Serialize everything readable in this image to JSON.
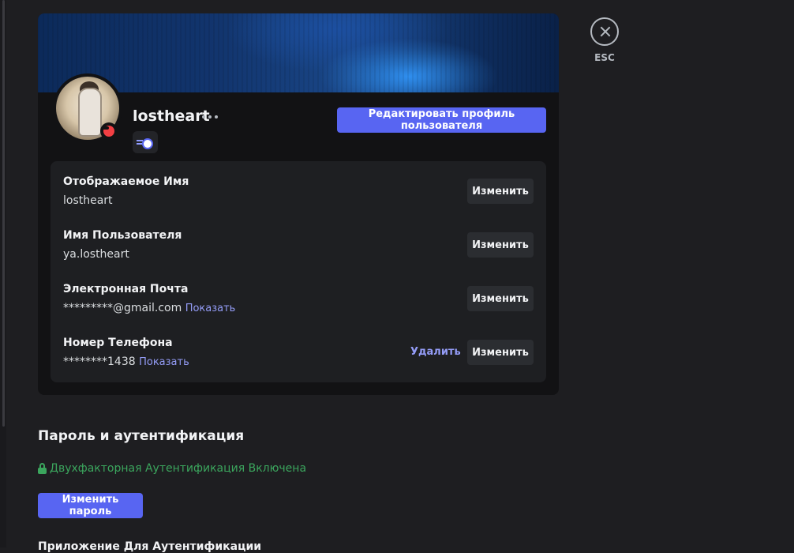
{
  "profile": {
    "username": "lostheart",
    "edit_button": "Редактировать профиль пользователя"
  },
  "fields": [
    {
      "label": "Отображаемое Имя",
      "value": "lostheart",
      "button": "Изменить"
    },
    {
      "label": "Имя Пользователя",
      "value": "ya.lostheart",
      "button": "Изменить"
    },
    {
      "label": "Электронная Почта",
      "value": "*********@gmail.com",
      "reveal": "Показать",
      "button": "Изменить"
    },
    {
      "label": "Номер Телефона",
      "value": "********1438",
      "reveal": "Показать",
      "delete": "Удалить",
      "button": "Изменить"
    }
  ],
  "close": {
    "label": "ESC"
  },
  "auth": {
    "title": "Пароль и аутентификация",
    "twofa_status": "Двухфакторная Аутентификация Включена",
    "change_password": "Изменить пароль",
    "next_heading": "Приложение Для Аутентификации"
  },
  "colors": {
    "accent": "#5865f2",
    "success": "#3ba55d",
    "link": "#949cf7",
    "dnd": "#f23f43"
  }
}
